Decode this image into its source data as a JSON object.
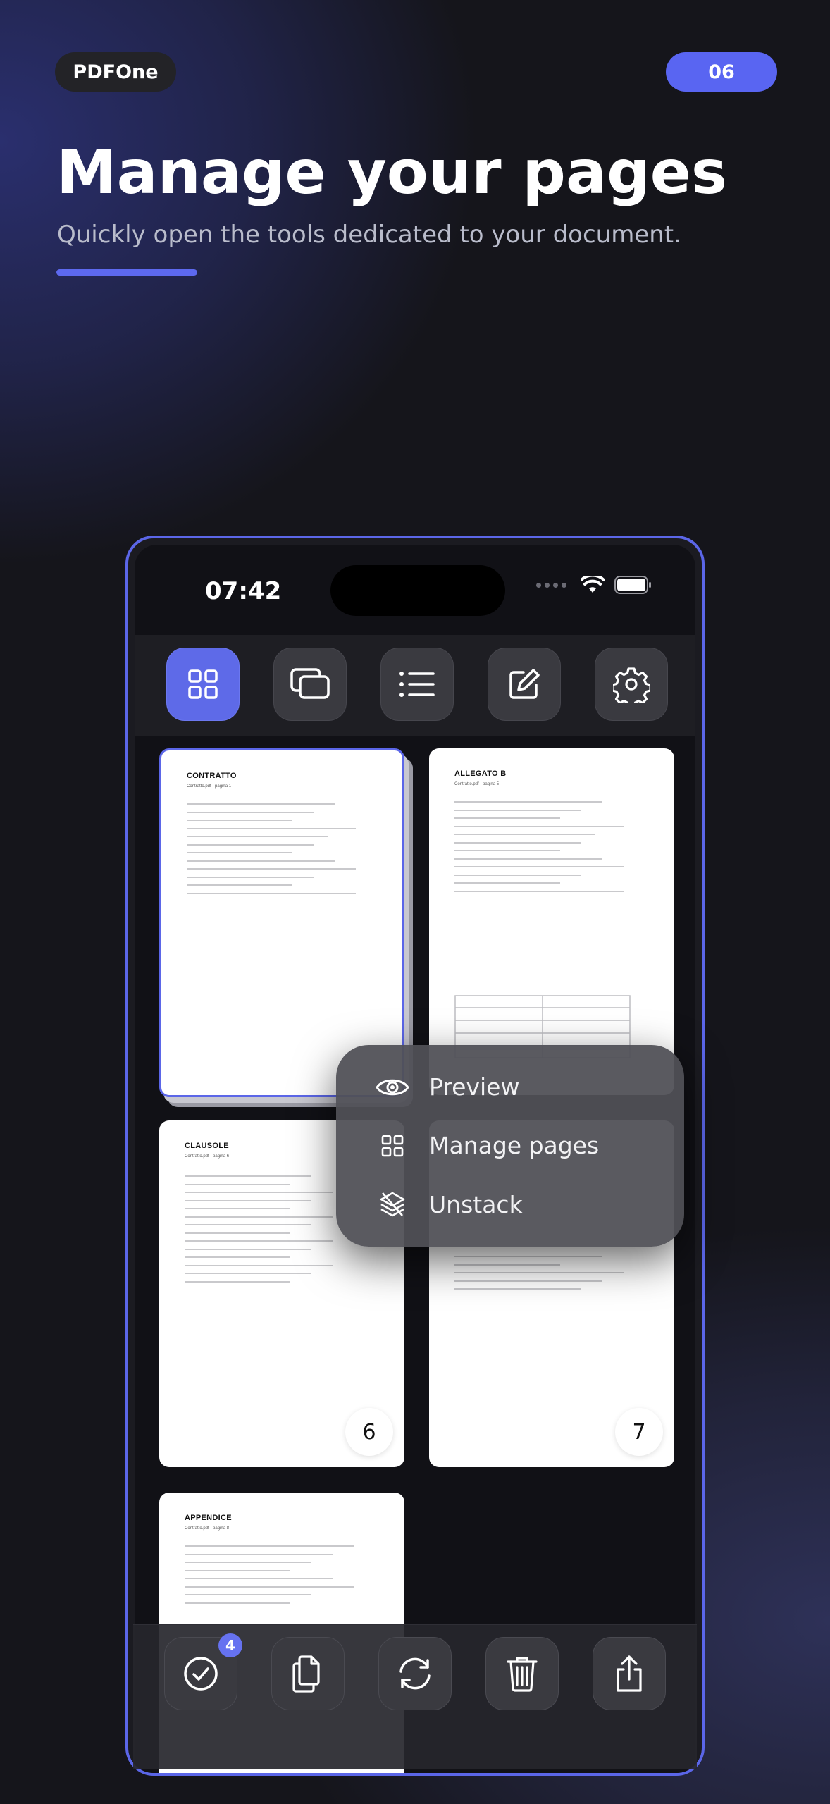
{
  "header": {
    "brand": "PDFOne",
    "step": "06",
    "title": "Manage your pages",
    "subtitle": "Quickly open the tools dedicated to your document."
  },
  "status_bar": {
    "time": "07:42"
  },
  "top_toolbar": {
    "icons": [
      "grid-icon",
      "stack-icon",
      "list-icon",
      "edit-icon",
      "settings-icon"
    ]
  },
  "pages": [
    {
      "title": "CONTRATTO",
      "subtitle": "Contratto.pdf · pagina 1",
      "selected": true
    },
    {
      "title": "ALLEGATO B",
      "subtitle": "Contratto.pdf · pagina 5"
    },
    {
      "title": "CLAUSOLE",
      "subtitle": "Contratto.pdf · pagina 6",
      "number": "6"
    },
    {
      "title": "",
      "subtitle": "",
      "number": "7"
    },
    {
      "title": "APPENDICE",
      "subtitle": "Contratto.pdf · pagina 8"
    }
  ],
  "context_menu": {
    "items": [
      {
        "label": "Preview",
        "icon": "eye-icon"
      },
      {
        "label": "Manage pages",
        "icon": "grid-icon"
      },
      {
        "label": "Unstack",
        "icon": "layers-icon"
      }
    ]
  },
  "bottom_toolbar": {
    "select_badge": "4",
    "icons": [
      "checkmark-icon",
      "duplicate-icon",
      "rotate-icon",
      "trash-icon",
      "share-icon"
    ]
  },
  "colors": {
    "accent": "#5965f2",
    "background": "#15151b"
  }
}
